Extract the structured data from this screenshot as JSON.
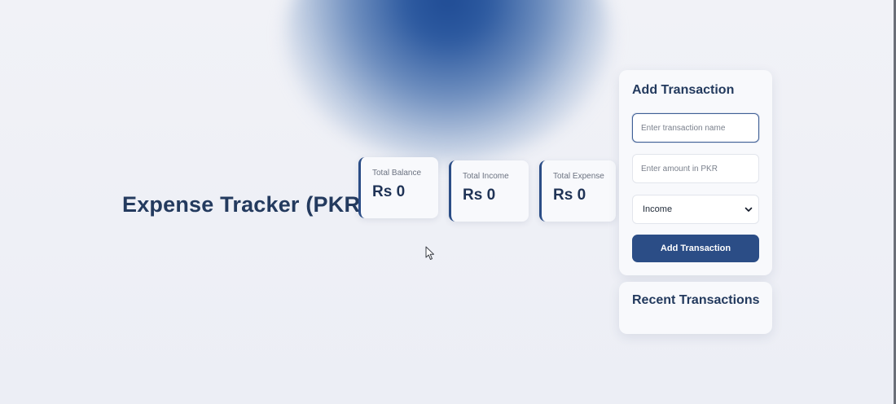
{
  "header": {
    "title": "Expense Tracker (PKR)"
  },
  "summary": {
    "cards": [
      {
        "label": "Total Balance",
        "value": "Rs 0"
      },
      {
        "label": "Total Income",
        "value": "Rs 0"
      },
      {
        "label": "Total Expense",
        "value": "Rs 0"
      }
    ]
  },
  "add_transaction": {
    "heading": "Add Transaction",
    "name_placeholder": "Enter transaction name",
    "amount_placeholder": "Enter amount in PKR",
    "type_selected": "Income",
    "submit_label": "Add Transaction"
  },
  "recent_transactions": {
    "heading": "Recent Transactions"
  },
  "colors": {
    "accent": "#2b4d86",
    "title": "#233a5e",
    "background": "#eef0f6"
  },
  "icons": {
    "select": "chevron-down-icon",
    "pointer": "mouse-cursor-icon"
  }
}
